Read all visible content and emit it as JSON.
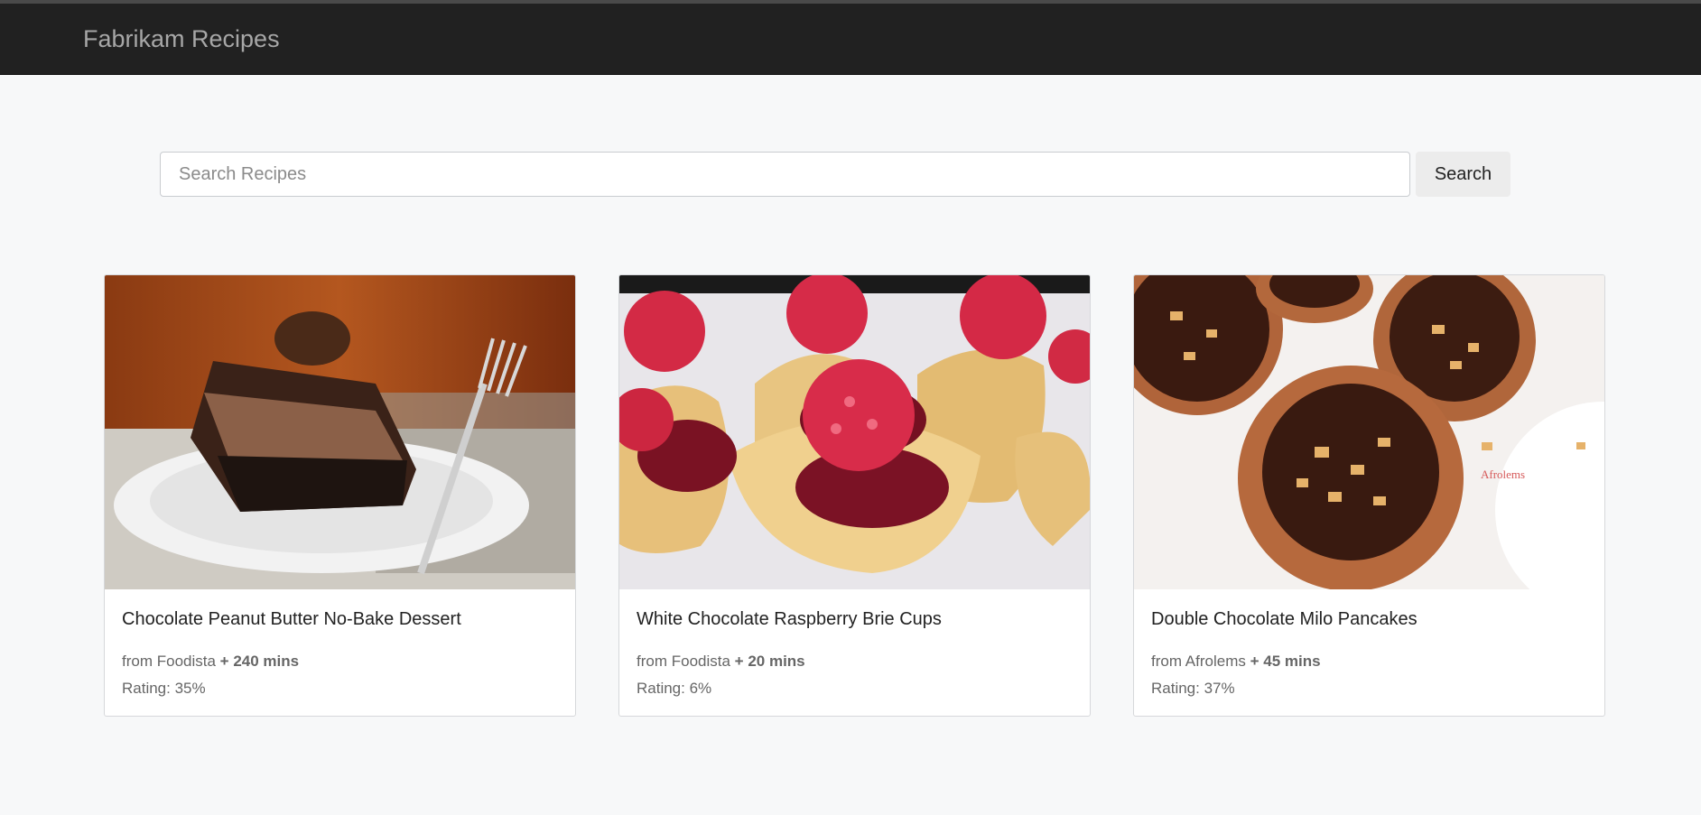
{
  "navbar": {
    "brand": "Fabrikam Recipes"
  },
  "search": {
    "placeholder": "Search Recipes",
    "value": "",
    "button_label": "Search"
  },
  "recipes": [
    {
      "title": "Chocolate Peanut Butter No-Bake Dessert",
      "from_prefix": "from",
      "source": "Foodista",
      "time": "+ 240 mins",
      "rating": "Rating: 35%"
    },
    {
      "title": "White Chocolate Raspberry Brie Cups",
      "from_prefix": "from",
      "source": "Foodista",
      "time": "+ 20 mins",
      "rating": "Rating: 6%"
    },
    {
      "title": "Double Chocolate Milo Pancakes",
      "from_prefix": "from",
      "source": "Afrolems",
      "time": "+ 45 mins",
      "rating": "Rating: 37%",
      "photo_watermark": "Afrolems"
    }
  ],
  "colors": {
    "navbar_bg": "#212121",
    "brand_text": "#a7a7a7",
    "page_bg": "#f7f8f9",
    "button_bg": "#ececec"
  }
}
